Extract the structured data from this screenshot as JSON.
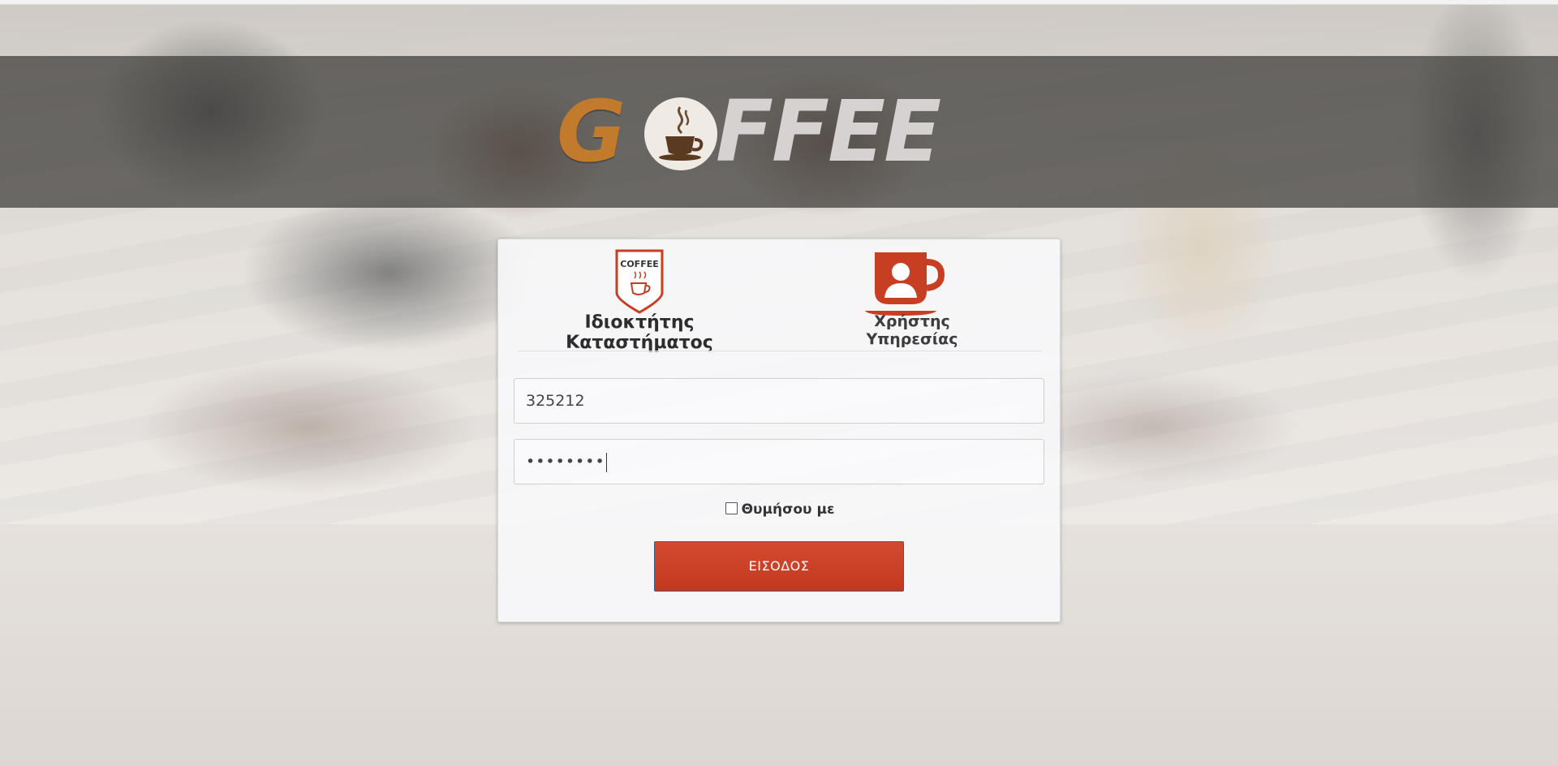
{
  "brand": {
    "logo_text_first": "G",
    "logo_text_rest": "FFEE",
    "colors": {
      "accent": "#c73e23",
      "logo_orange": "#c27a2c",
      "logo_grey": "#d6d2d2"
    }
  },
  "login": {
    "roles": [
      {
        "label": "Ιδιοκτήτης Καταστήματος",
        "icon": "coffee-shop-badge-icon",
        "badge_text": "COFFEE"
      },
      {
        "label": "Χρήστης Υπηρεσίας",
        "icon": "user-cup-icon"
      }
    ],
    "username_value": "325212",
    "password_mask": "••••••••",
    "remember_label": "Θυμήσου με",
    "remember_checked": false,
    "submit_label": "ΕΙΣΟΔΟΣ"
  }
}
